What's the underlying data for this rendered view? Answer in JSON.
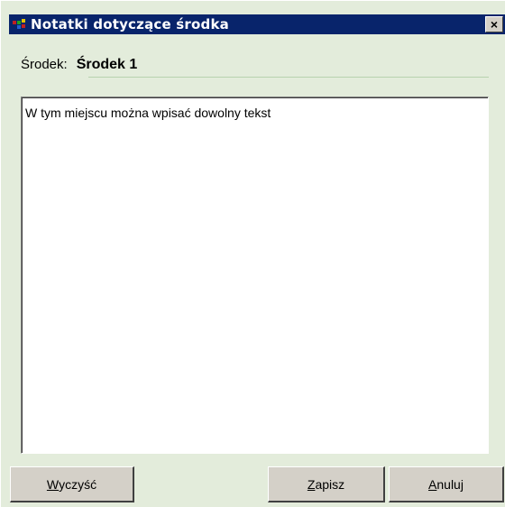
{
  "window": {
    "title": "Notatki dotyczące środka",
    "close_label": "×"
  },
  "field": {
    "label": "Środek:",
    "value": "Środek 1"
  },
  "notes": {
    "text": "W tym miejscu można wpisać dowolny tekst"
  },
  "buttons": {
    "clear": {
      "accel": "W",
      "rest": "yczyść"
    },
    "save": {
      "accel": "Z",
      "rest": "apisz"
    },
    "cancel": {
      "accel": "A",
      "rest": "nuluj"
    }
  },
  "colors": {
    "titlebar": "#08246b",
    "window_bg": "#e3ecdb",
    "button_face": "#d4d0c8"
  },
  "icons": [
    "app-icon",
    "close-icon"
  ]
}
